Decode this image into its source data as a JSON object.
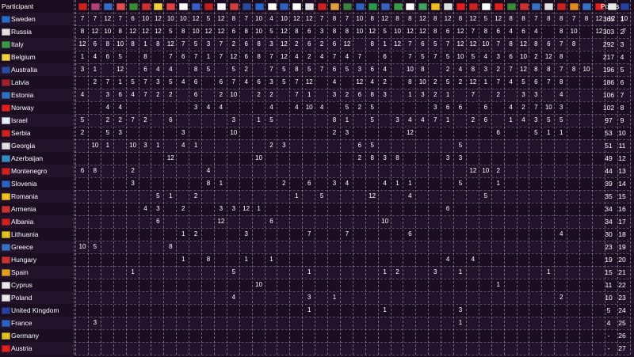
{
  "header": {
    "participant_label": "Participant",
    "points_label": "Points",
    "place_label": "Place"
  },
  "voter_flags": [
    "#cc2222",
    "#b0407a",
    "#3a6bc4",
    "#e05050",
    "#3a8a3a",
    "#cc3030",
    "#f0d040",
    "#e04040",
    "#ffffff",
    "#3a5fc4",
    "#c02020",
    "#ffffff",
    "#d04040",
    "#2a4a9a",
    "#2a66cc",
    "#ffffff",
    "#3060c0",
    "#ffffff",
    "#e0e0e0",
    "#cc2222",
    "#e0a040",
    "#3a8040",
    "#3060c0",
    "#2a9a4a",
    "#3a60c0",
    "#3a9a4a",
    "#ffffff",
    "#40a060",
    "#f0c020",
    "#e0e0e0",
    "#dd2020",
    "#cc2222",
    "#ffffff",
    "#dd2020",
    "#3a8a3a",
    "#cc3030",
    "#3a70c0",
    "#e0e0e0",
    "#cc2222",
    "#e08a20",
    "#3a70c0",
    "#dd2020",
    "#e0e0e0",
    "#2a40a0"
  ],
  "participants": [
    {
      "name": "Sweden",
      "flag": "#2a6cc4",
      "votes": [
        "7",
        "7",
        "12",
        "7",
        "6",
        "10",
        "12",
        "10",
        "10",
        "12",
        "5",
        "12",
        "8",
        "7",
        "10",
        "4",
        "10",
        "12",
        "12",
        "7",
        "8",
        "7",
        "10",
        "8",
        "12",
        "8",
        "8",
        "12",
        "8",
        "12",
        "8",
        "12",
        "5",
        "12",
        "8",
        "8",
        "7",
        "8",
        "8",
        "7",
        "8",
        "12",
        "12",
        "10"
      ],
      "points": "365",
      "place": "1"
    },
    {
      "name": "Russia",
      "flag": "#e0e0e0",
      "votes": [
        "8",
        "12",
        "10",
        "8",
        "12",
        "12",
        "12",
        "5",
        "8",
        "10",
        "12",
        "12",
        "6",
        "8",
        "10",
        "5",
        "12",
        "8",
        "6",
        "3",
        "8",
        "8",
        "10",
        "12",
        "5",
        "10",
        "12",
        "12",
        "8",
        "6",
        "12",
        "7",
        "8",
        "6",
        "4",
        "6",
        "4",
        "",
        "8",
        "10",
        "",
        "12",
        "",
        "7"
      ],
      "points": "303",
      "place": "2"
    },
    {
      "name": "Italy",
      "flag": "#3a9a4a",
      "votes": [
        "12",
        "6",
        "8",
        "10",
        "8",
        "1",
        "8",
        "12",
        "7",
        "5",
        "3",
        "7",
        "2",
        "6",
        "8",
        "3",
        "12",
        "2",
        "6",
        "2",
        "6",
        "12",
        "",
        "8",
        "1",
        "12",
        "7",
        "6",
        "5",
        "7",
        "12",
        "12",
        "10",
        "7",
        "8",
        "12",
        "8",
        "6",
        "7",
        "8",
        "",
        "",
        "",
        ""
      ],
      "points": "292",
      "place": "3"
    },
    {
      "name": "Belgium",
      "flag": "#f0d040",
      "votes": [
        "1",
        "4",
        "6",
        "5",
        "",
        "8",
        "",
        "7",
        "6",
        "7",
        "1",
        "7",
        "12",
        "6",
        "8",
        "7",
        "12",
        "4",
        "2",
        "4",
        "7",
        "4",
        "7",
        "",
        "6",
        "",
        "7",
        "5",
        "7",
        "5",
        "10",
        "5",
        "4",
        "3",
        "6",
        "10",
        "2",
        "12",
        "8",
        "",
        "",
        "",
        "",
        ""
      ],
      "points": "217",
      "place": "4"
    },
    {
      "name": "Australia",
      "flag": "#2a4a9a",
      "votes": [
        "3",
        "1",
        "",
        "12",
        "",
        "6",
        "4",
        "4",
        "",
        "8",
        "5",
        "",
        "5",
        "2",
        "",
        "7",
        "5",
        "8",
        "5",
        "7",
        "6",
        "5",
        "3",
        "6",
        "4",
        "",
        "10",
        "8",
        "",
        "2",
        "4",
        "8",
        "3",
        "2",
        "7",
        "12",
        "8",
        "8",
        "7",
        "8",
        "10",
        "",
        "",
        ""
      ],
      "points": "196",
      "place": "5"
    },
    {
      "name": "Latvia",
      "flag": "#a02030",
      "votes": [
        "",
        "2",
        "7",
        "1",
        "5",
        "7",
        "3",
        "5",
        "4",
        "6",
        "",
        "6",
        "7",
        "4",
        "6",
        "3",
        "5",
        "7",
        "12",
        "",
        "4",
        "",
        "12",
        "4",
        "2",
        "",
        "8",
        "10",
        "2",
        "5",
        "2",
        "12",
        "1",
        "7",
        "4",
        "5",
        "6",
        "7",
        "8",
        "",
        "",
        "",
        "",
        ""
      ],
      "points": "186",
      "place": "6"
    },
    {
      "name": "Estonia",
      "flag": "#3070c0",
      "votes": [
        "4",
        "",
        "3",
        "6",
        "4",
        "7",
        "2",
        "2",
        "",
        "6",
        "",
        "2",
        "10",
        "",
        "2",
        "2",
        "",
        "7",
        "1",
        "",
        "3",
        "2",
        "6",
        "8",
        "3",
        "",
        "1",
        "3",
        "2",
        "1",
        "",
        "7",
        "",
        "2",
        "",
        "3",
        "3",
        "",
        "4",
        "",
        "",
        "",
        "",
        ""
      ],
      "points": "106",
      "place": "7"
    },
    {
      "name": "Norway",
      "flag": "#dd2020",
      "votes": [
        "",
        "",
        "4",
        "4",
        "",
        "",
        "",
        "",
        "",
        "3",
        "4",
        "4",
        "",
        "",
        "",
        "4",
        "",
        "4",
        "10",
        "4",
        "",
        "5",
        "2",
        "5",
        "",
        "",
        "",
        "",
        "3",
        "6",
        "6",
        "",
        "6",
        "",
        "4",
        "2",
        "7",
        "10",
        "3",
        "",
        "",
        "",
        "",
        ""
      ],
      "points": "102",
      "place": "8"
    },
    {
      "name": "Israel",
      "flag": "#e8eef8",
      "votes": [
        "5",
        "",
        "2",
        "2",
        "7",
        "2",
        "",
        "6",
        "",
        "",
        "",
        "",
        "3",
        "",
        "1",
        "5",
        "",
        "",
        "",
        "",
        "8",
        "1",
        "",
        "5",
        "",
        "3",
        "4",
        "4",
        "7",
        "1",
        "",
        "2",
        "6",
        "",
        "1",
        "4",
        "3",
        "5",
        "5",
        "",
        "",
        "",
        "",
        ""
      ],
      "points": "97",
      "place": "9"
    },
    {
      "name": "Serbia",
      "flag": "#cc2222",
      "votes": [
        "2",
        "",
        "5",
        "3",
        "",
        "",
        "",
        "",
        "3",
        "",
        "",
        "",
        "10",
        "",
        "",
        "",
        "",
        "",
        "",
        "",
        "2",
        "3",
        "",
        "",
        "",
        "",
        "12",
        "",
        "",
        "",
        "",
        "",
        "",
        "6",
        "",
        "",
        "5",
        "1",
        "1",
        "",
        "",
        "",
        "",
        ""
      ],
      "points": "53",
      "place": "10"
    },
    {
      "name": "Georgia",
      "flag": "#e0e0e0",
      "votes": [
        "",
        "10",
        "1",
        "",
        "10",
        "3",
        "1",
        "",
        "4",
        "1",
        "",
        "",
        "",
        "",
        "",
        "2",
        "3",
        "",
        "",
        "",
        "",
        "",
        "6",
        "5",
        "",
        "",
        "",
        "",
        "",
        "",
        "5",
        "",
        "",
        "",
        "",
        "",
        "",
        "",
        "",
        "",
        "",
        "",
        "",
        ""
      ],
      "points": "51",
      "place": "11"
    },
    {
      "name": "Azerbaijan",
      "flag": "#3a8ac0",
      "votes": [
        "",
        "",
        "",
        "",
        "",
        "",
        "",
        "12",
        "",
        "",
        "",
        "",
        "",
        "",
        "10",
        "",
        "",
        "",
        "",
        "",
        "",
        "",
        "2",
        "8",
        "3",
        "8",
        "",
        "",
        "",
        "3",
        "3",
        "",
        "",
        "",
        "",
        "",
        "",
        "",
        "",
        "",
        "",
        "",
        "",
        ""
      ],
      "points": "49",
      "place": "12"
    },
    {
      "name": "Montenegro",
      "flag": "#cc2222",
      "votes": [
        "6",
        "8",
        "",
        "",
        "2",
        "",
        "",
        "",
        "",
        "",
        "4",
        "",
        "",
        "",
        "",
        "",
        "",
        "",
        "",
        "",
        "",
        "",
        "",
        "",
        "",
        "",
        "",
        "",
        "",
        "",
        "",
        "12",
        "10",
        "2",
        "",
        "",
        "",
        "",
        "",
        "",
        "",
        "",
        "",
        ""
      ],
      "points": "44",
      "place": "13"
    },
    {
      "name": "Slovenia",
      "flag": "#3060c0",
      "votes": [
        "",
        "",
        "",
        "",
        "3",
        "",
        "",
        "",
        "",
        "",
        "8",
        "1",
        "",
        "",
        "",
        "",
        "2",
        "",
        "6",
        "",
        "3",
        "4",
        "",
        "",
        "4",
        "1",
        "1",
        "",
        "",
        "",
        "5",
        "",
        "",
        "1",
        "",
        "",
        "",
        "",
        "",
        "",
        "",
        "",
        "",
        ""
      ],
      "points": "39",
      "place": "14"
    },
    {
      "name": "Romania",
      "flag": "#f0c020",
      "votes": [
        "",
        "",
        "",
        "",
        "",
        "",
        "5",
        "1",
        "",
        "2",
        "",
        "",
        "",
        "",
        "",
        "",
        "",
        "1",
        "",
        "5",
        "",
        "",
        "",
        "12",
        "",
        "",
        "4",
        "",
        "",
        "",
        "",
        "",
        "5",
        "",
        "",
        "",
        "",
        "",
        "",
        "",
        "",
        "",
        "",
        ""
      ],
      "points": "35",
      "place": "15"
    },
    {
      "name": "Armenia",
      "flag": "#cc3030",
      "votes": [
        "",
        "",
        "",
        "",
        "",
        "4",
        "3",
        "",
        "2",
        "",
        "",
        "3",
        "3",
        "12",
        "1",
        "",
        "",
        "",
        "",
        "",
        "",
        "",
        "",
        "",
        "",
        "",
        "",
        "",
        "",
        "6",
        "",
        "",
        "",
        "",
        "",
        "",
        "",
        "",
        "",
        "",
        "",
        "",
        "",
        ""
      ],
      "points": "34",
      "place": "16"
    },
    {
      "name": "Albania",
      "flag": "#cc2222",
      "votes": [
        "",
        "",
        "",
        "",
        "",
        "",
        "6",
        "",
        "",
        "",
        "",
        "12",
        "",
        "",
        "",
        "6",
        "",
        "",
        "",
        "",
        "",
        "",
        "",
        "",
        "10",
        "",
        "",
        "",
        "",
        "",
        "",
        "",
        "",
        "",
        "",
        "",
        "",
        "",
        "",
        "",
        "",
        "",
        "",
        ""
      ],
      "points": "34",
      "place": "17"
    },
    {
      "name": "Lithuania",
      "flag": "#e0c020",
      "votes": [
        "",
        "",
        "",
        "",
        "",
        "",
        "",
        "",
        "1",
        "2",
        "",
        "",
        "",
        "3",
        "",
        "",
        "",
        "",
        "7",
        "",
        "",
        "7",
        "",
        "",
        "",
        "",
        "6",
        "",
        "",
        "",
        "",
        "",
        "",
        "",
        "",
        "",
        "",
        "",
        "4",
        "",
        "",
        "",
        "",
        ""
      ],
      "points": "30",
      "place": "18"
    },
    {
      "name": "Greece",
      "flag": "#3a70c0",
      "votes": [
        "10",
        "5",
        "",
        "",
        "",
        "",
        "",
        "8",
        "",
        "",
        "",
        "",
        "",
        "",
        "",
        "",
        "",
        "",
        "",
        "",
        "",
        "",
        "",
        "",
        "",
        "",
        "",
        "",
        "",
        "",
        "",
        "",
        "",
        "",
        "",
        "",
        "",
        "",
        "",
        "",
        "",
        "",
        "",
        ""
      ],
      "points": "23",
      "place": "19"
    },
    {
      "name": "Hungary",
      "flag": "#cc3030",
      "votes": [
        "",
        "",
        "",
        "",
        "",
        "",
        "",
        "",
        "1",
        "",
        "8",
        "",
        "",
        "1",
        "",
        "1",
        "",
        "",
        "",
        "",
        "",
        "",
        "",
        "",
        "",
        "",
        "",
        "",
        "",
        "4",
        "",
        "4",
        "",
        "",
        "",
        "",
        "",
        "",
        "",
        "",
        "",
        "",
        "",
        ""
      ],
      "points": "19",
      "place": "20"
    },
    {
      "name": "Spain",
      "flag": "#e0a020",
      "votes": [
        "",
        "",
        "",
        "",
        "1",
        "",
        "",
        "",
        "",
        "",
        "",
        "",
        "5",
        "",
        "",
        "",
        "",
        "",
        "1",
        "",
        "",
        "",
        "",
        "",
        "1",
        "2",
        "",
        "",
        "3",
        "",
        "1",
        "",
        "",
        "",
        "",
        "",
        "",
        "1",
        "",
        "",
        "",
        "",
        "",
        ""
      ],
      "points": "15",
      "place": "21"
    },
    {
      "name": "Cyprus",
      "flag": "#e8e8e8",
      "votes": [
        "",
        "",
        "",
        "",
        "",
        "",
        "",
        "",
        "",
        "",
        "",
        "",
        "",
        "",
        "10",
        "",
        "",
        "",
        "",
        "",
        "",
        "",
        "",
        "",
        "",
        "",
        "",
        "",
        "",
        "",
        "",
        "",
        "",
        "1",
        "",
        "",
        "",
        "",
        "",
        "",
        "",
        "",
        "",
        ""
      ],
      "points": "11",
      "place": "22"
    },
    {
      "name": "Poland",
      "flag": "#e8e8e8",
      "votes": [
        "",
        "",
        "",
        "",
        "",
        "",
        "",
        "",
        "",
        "",
        "",
        "",
        "4",
        "",
        "",
        "",
        "",
        "",
        "3",
        "",
        "1",
        "",
        "",
        "",
        "",
        "",
        "",
        "",
        "",
        "",
        "",
        "",
        "",
        "",
        "",
        "",
        "",
        "",
        "2",
        "",
        "",
        "",
        "",
        ""
      ],
      "points": "10",
      "place": "23"
    },
    {
      "name": "United Kingdom",
      "flag": "#2a40a0",
      "votes": [
        "",
        "",
        "",
        "",
        "",
        "",
        "",
        "",
        "",
        "",
        "",
        "",
        "",
        "",
        "",
        "",
        "",
        "",
        "1",
        "",
        "",
        "",
        "",
        "",
        "1",
        "",
        "",
        "",
        "",
        "",
        "3",
        "",
        "",
        "",
        "",
        "",
        "",
        "",
        "",
        "",
        "",
        "",
        "",
        ""
      ],
      "points": "5",
      "place": "24"
    },
    {
      "name": "France",
      "flag": "#3060c0",
      "votes": [
        "",
        "3",
        "",
        "",
        "",
        "",
        "",
        "",
        "",
        "",
        "",
        "",
        "",
        "",
        "",
        "",
        "",
        "",
        "",
        "",
        "",
        "",
        "",
        "",
        "",
        "",
        "",
        "",
        "",
        "",
        "1",
        "",
        "",
        "",
        "",
        "",
        "",
        "",
        "",
        "",
        "",
        "",
        "",
        ""
      ],
      "points": "4",
      "place": "25"
    },
    {
      "name": "Germany",
      "flag": "#e0c020",
      "votes": [
        "",
        "",
        "",
        "",
        "",
        "",
        "",
        "",
        "",
        "",
        "",
        "",
        "",
        "",
        "",
        "",
        "",
        "",
        "",
        "",
        "",
        "",
        "",
        "",
        "",
        "",
        "",
        "",
        "",
        "",
        "",
        "",
        "",
        "",
        "",
        "",
        "",
        "",
        "",
        "",
        "",
        "",
        "",
        ""
      ],
      "points": "-",
      "place": "26"
    },
    {
      "name": "Austria",
      "flag": "#dd2020",
      "votes": [
        "",
        "",
        "",
        "",
        "",
        "",
        "",
        "",
        "",
        "",
        "",
        "",
        "",
        "",
        "",
        "",
        "",
        "",
        "",
        "",
        "",
        "",
        "",
        "",
        "",
        "",
        "",
        "",
        "",
        "",
        "",
        "",
        "",
        "",
        "",
        "",
        "",
        "",
        "",
        "",
        "",
        "",
        "",
        ""
      ],
      "points": "-",
      "place": "27"
    }
  ]
}
